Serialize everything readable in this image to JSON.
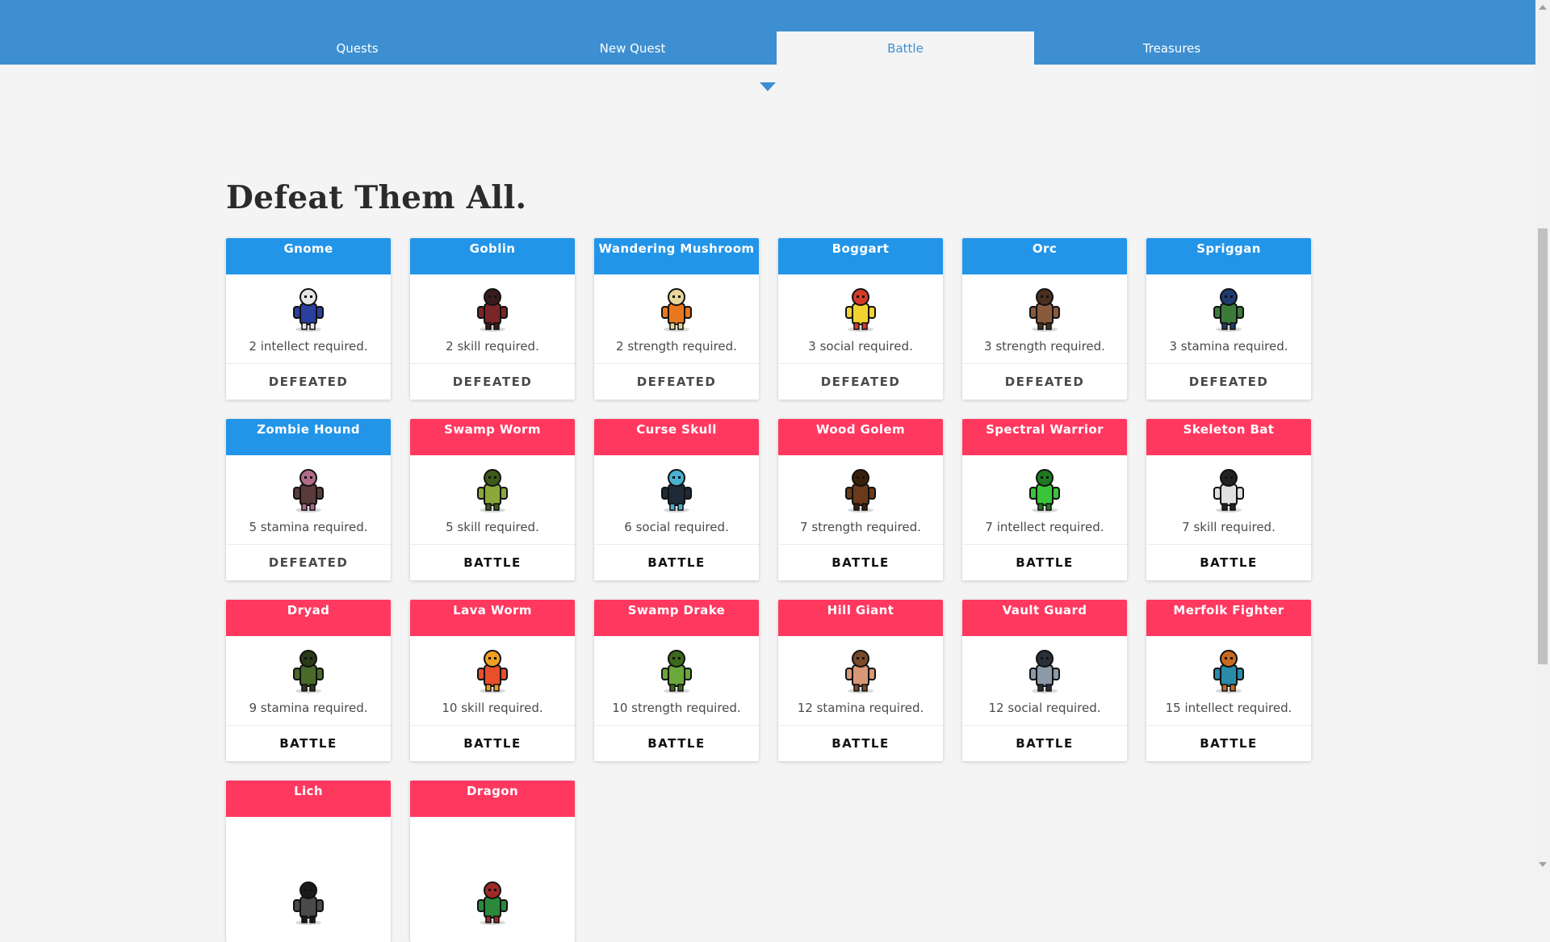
{
  "nav": {
    "tabs": [
      {
        "label": "Quests",
        "active": false
      },
      {
        "label": "New Quest",
        "active": false
      },
      {
        "label": "Battle",
        "active": true
      },
      {
        "label": "Treasures",
        "active": false
      }
    ]
  },
  "page": {
    "title": "Defeat Them All."
  },
  "colors": {
    "accent": "#3d8fd1",
    "defeated_header": "#2295e8",
    "battle_header": "#ff3860"
  },
  "monsters": [
    {
      "name": "Gnome",
      "requirement": "2 intellect required.",
      "action": "DEFEATED",
      "status": "defeated",
      "icon": "gnome-sprite-icon",
      "c1": "#2a3f9e",
      "c2": "#e6e6e6"
    },
    {
      "name": "Goblin",
      "requirement": "2 skill required.",
      "action": "DEFEATED",
      "status": "defeated",
      "icon": "goblin-sprite-icon",
      "c1": "#7a2626",
      "c2": "#3a1c1c"
    },
    {
      "name": "Wandering Mushroom",
      "requirement": "2 strength required.",
      "action": "DEFEATED",
      "status": "defeated",
      "icon": "mushroom-sprite-icon",
      "c1": "#e8771e",
      "c2": "#e8d79a"
    },
    {
      "name": "Boggart",
      "requirement": "3 social required.",
      "action": "DEFEATED",
      "status": "defeated",
      "icon": "boggart-sprite-icon",
      "c1": "#f2d230",
      "c2": "#d63a2a"
    },
    {
      "name": "Orc",
      "requirement": "3 strength required.",
      "action": "DEFEATED",
      "status": "defeated",
      "icon": "orc-sprite-icon",
      "c1": "#8a5a3c",
      "c2": "#4a3020"
    },
    {
      "name": "Spriggan",
      "requirement": "3 stamina required.",
      "action": "DEFEATED",
      "status": "defeated",
      "icon": "spriggan-sprite-icon",
      "c1": "#3c7a3a",
      "c2": "#1f3a6e"
    },
    {
      "name": "Zombie Hound",
      "requirement": "5 stamina required.",
      "action": "DEFEATED",
      "status": "defeated",
      "icon": "zombie-hound-sprite-icon",
      "c1": "#5a3a3a",
      "c2": "#b06a8a"
    },
    {
      "name": "Swamp Worm",
      "requirement": "5 skill required.",
      "action": "BATTLE",
      "status": "active",
      "icon": "swamp-worm-sprite-icon",
      "c1": "#8aa83a",
      "c2": "#3e5a1a"
    },
    {
      "name": "Curse Skull",
      "requirement": "6 social required.",
      "action": "BATTLE",
      "status": "active",
      "icon": "curse-skull-sprite-icon",
      "c1": "#1e2a38",
      "c2": "#4ab0d0"
    },
    {
      "name": "Wood Golem",
      "requirement": "7 strength required.",
      "action": "BATTLE",
      "status": "active",
      "icon": "wood-golem-sprite-icon",
      "c1": "#6a3a1a",
      "c2": "#3a200c"
    },
    {
      "name": "Spectral Warrior",
      "requirement": "7 intellect required.",
      "action": "BATTLE",
      "status": "active",
      "icon": "spectral-warrior-sprite-icon",
      "c1": "#3ac43a",
      "c2": "#1e7a1e"
    },
    {
      "name": "Skeleton Bat",
      "requirement": "7 skill required.",
      "action": "BATTLE",
      "status": "active",
      "icon": "skeleton-bat-sprite-icon",
      "c1": "#e0e0e0",
      "c2": "#222222"
    },
    {
      "name": "Dryad",
      "requirement": "9 stamina required.",
      "action": "BATTLE",
      "status": "active",
      "icon": "dryad-sprite-icon",
      "c1": "#4a6a2a",
      "c2": "#2a3a16"
    },
    {
      "name": "Lava Worm",
      "requirement": "10 skill required.",
      "action": "BATTLE",
      "status": "active",
      "icon": "lava-worm-sprite-icon",
      "c1": "#e8502a",
      "c2": "#f0a020"
    },
    {
      "name": "Swamp Drake",
      "requirement": "10 strength required.",
      "action": "BATTLE",
      "status": "active",
      "icon": "swamp-drake-sprite-icon",
      "c1": "#6aa83a",
      "c2": "#3a6a1a"
    },
    {
      "name": "Hill Giant",
      "requirement": "12 stamina required.",
      "action": "BATTLE",
      "status": "active",
      "icon": "hill-giant-sprite-icon",
      "c1": "#d89878",
      "c2": "#7a4a2a"
    },
    {
      "name": "Vault Guard",
      "requirement": "12 social required.",
      "action": "BATTLE",
      "status": "active",
      "icon": "vault-guard-sprite-icon",
      "c1": "#8a9aa8",
      "c2": "#2a3038"
    },
    {
      "name": "Merfolk Fighter",
      "requirement": "15 intellect required.",
      "action": "BATTLE",
      "status": "active",
      "icon": "merfolk-fighter-sprite-icon",
      "c1": "#2a8aa8",
      "c2": "#c86a1e"
    },
    {
      "name": "Lich",
      "requirement": "",
      "action": "",
      "status": "active",
      "icon": "lich-sprite-icon",
      "c1": "#4a4a4a",
      "c2": "#1a1a1a"
    },
    {
      "name": "Dragon",
      "requirement": "",
      "action": "",
      "status": "active",
      "icon": "dragon-sprite-icon",
      "c1": "#2a8a3a",
      "c2": "#a02a2a"
    }
  ]
}
